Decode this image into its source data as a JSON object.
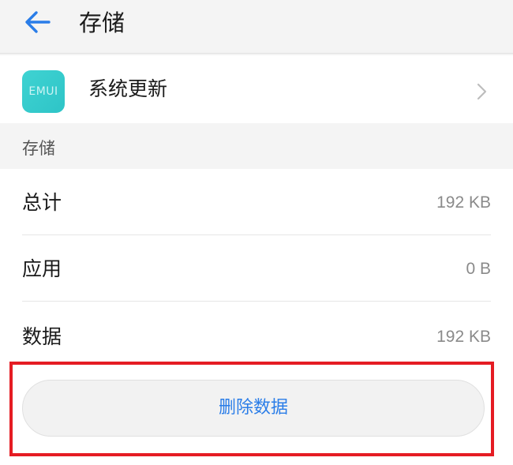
{
  "header": {
    "title": "存储",
    "back_icon": "arrow-left-icon",
    "accent_color": "#2a7de8"
  },
  "app": {
    "icon_text": "EMUI",
    "name": "系统更新"
  },
  "section": {
    "title": "存储"
  },
  "storage": {
    "rows": [
      {
        "label": "总计",
        "value": "192 KB"
      },
      {
        "label": "应用",
        "value": "0 B"
      },
      {
        "label": "数据",
        "value": "192 KB"
      }
    ]
  },
  "actions": {
    "delete_label": "删除数据",
    "highlight_color": "#e51c23"
  }
}
